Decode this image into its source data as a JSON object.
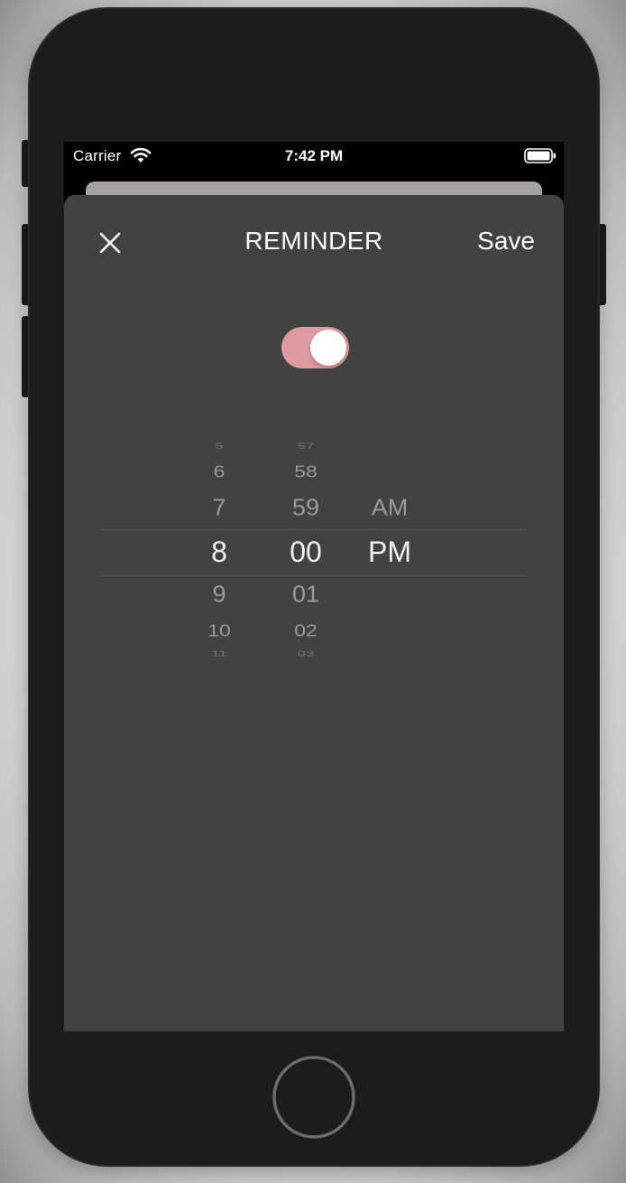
{
  "status_bar": {
    "carrier": "Carrier",
    "time": "7:42 PM",
    "wifi_icon": "wifi-icon",
    "battery_icon": "battery-icon"
  },
  "sheet": {
    "title": "REMINDER",
    "save_label": "Save",
    "close_icon": "close-icon"
  },
  "reminder_toggle": {
    "on": true,
    "color": "#df9aa0"
  },
  "picker": {
    "hours": [
      "5",
      "6",
      "7",
      "8",
      "9",
      "10",
      "11"
    ],
    "minutes": [
      "57",
      "58",
      "59",
      "00",
      "01",
      "02",
      "03"
    ],
    "periods": [
      "AM",
      "PM"
    ],
    "selected_hour": "8",
    "selected_minute": "00",
    "selected_period": "PM"
  },
  "colors": {
    "sheet_bg": "#424242",
    "toggle_on": "#df9aa0",
    "picker_text": "#9a9a9a",
    "picker_selected_text": "#f2f2f2"
  }
}
